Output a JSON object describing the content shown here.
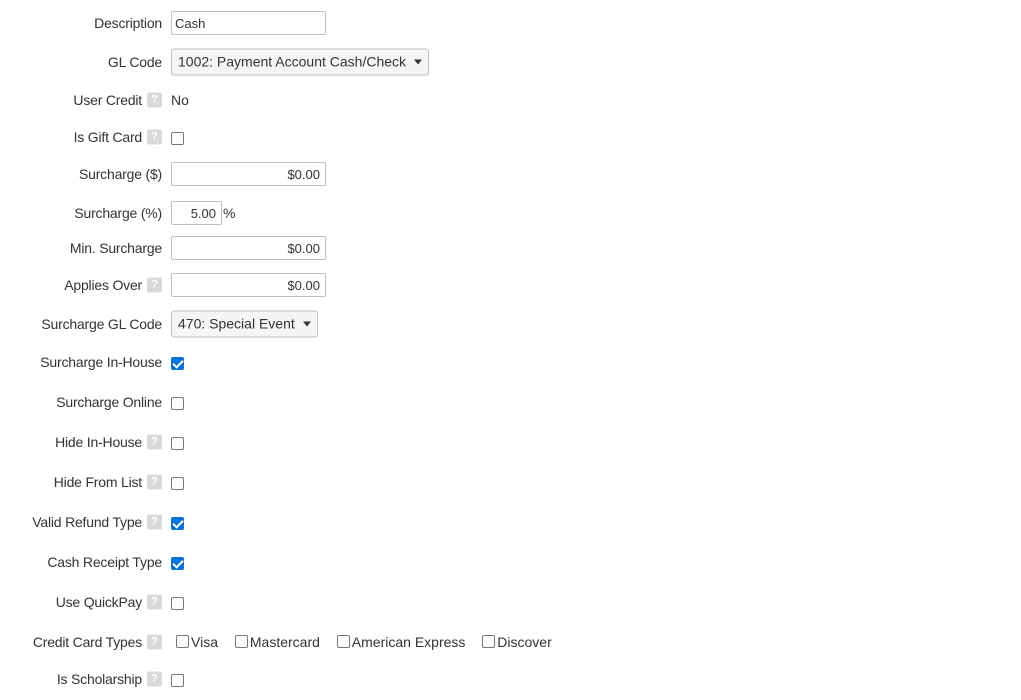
{
  "fields": {
    "description": {
      "label": "Description",
      "value": "Cash"
    },
    "gl_code": {
      "label": "GL Code",
      "value": "1002: Payment Account Cash/Check"
    },
    "user_credit": {
      "label": "User Credit",
      "value": "No"
    },
    "is_gift_card": {
      "label": "Is Gift Card",
      "checked": false
    },
    "surcharge_dollar": {
      "label": "Surcharge ($)",
      "value": "$0.00"
    },
    "surcharge_pct": {
      "label": "Surcharge (%)",
      "value": "5.00",
      "suffix": "%"
    },
    "min_surcharge": {
      "label": "Min. Surcharge",
      "value": "$0.00"
    },
    "applies_over": {
      "label": "Applies Over",
      "value": "$0.00"
    },
    "surcharge_gl_code": {
      "label": "Surcharge GL Code",
      "value": "470: Special Event"
    },
    "surcharge_in_house": {
      "label": "Surcharge In-House",
      "checked": true
    },
    "surcharge_online": {
      "label": "Surcharge Online",
      "checked": false
    },
    "hide_in_house": {
      "label": "Hide In-House",
      "checked": false
    },
    "hide_from_list": {
      "label": "Hide From List",
      "checked": false
    },
    "valid_refund_type": {
      "label": "Valid Refund Type",
      "checked": true
    },
    "cash_receipt_type": {
      "label": "Cash Receipt Type",
      "checked": true
    },
    "use_quickpay": {
      "label": "Use QuickPay",
      "checked": false
    },
    "credit_card_types": {
      "label": "Credit Card Types",
      "options": [
        {
          "label": "Visa",
          "checked": false
        },
        {
          "label": "Mastercard",
          "checked": false
        },
        {
          "label": "American Express",
          "checked": false
        },
        {
          "label": "Discover",
          "checked": false
        }
      ]
    },
    "is_scholarship": {
      "label": "Is Scholarship",
      "checked": false
    }
  },
  "help_glyph": "?",
  "icons": {
    "help": "help-icon",
    "dropdown": "chevron-down-icon"
  },
  "colors": {
    "checkbox_checked": "#0a73d9",
    "help_badge": "#d9d9d9",
    "input_border": "#bfbfbf"
  }
}
